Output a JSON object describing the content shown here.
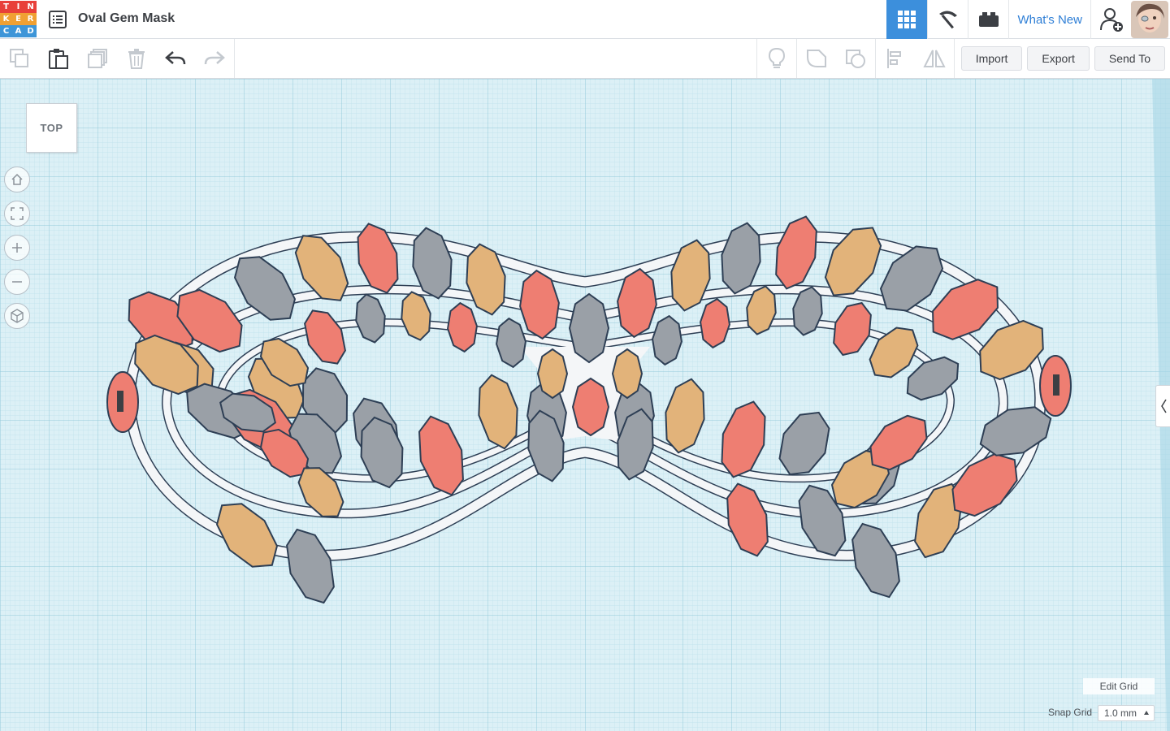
{
  "app": {
    "logo_letters": [
      "T",
      "I",
      "N",
      "K",
      "E",
      "R",
      "C",
      "A",
      "D"
    ],
    "logo_colors": [
      "#e8403a",
      "#e8403a",
      "#e8403a",
      "#f0a033",
      "#f0a033",
      "#f0a033",
      "#3d95d8",
      "#3d95d8",
      "#3d95d8"
    ],
    "design_title": "Oval Gem Mask",
    "whats_new_label": "What's New",
    "accent_color": "#3c8fdc"
  },
  "toolbar": {
    "left_icons": [
      "copy-icon",
      "paste-icon",
      "duplicate-icon",
      "delete-icon",
      "undo-icon",
      "redo-icon"
    ],
    "right_icons": [
      "note-icon",
      "group-icon",
      "ungroup-icon",
      "align-icon",
      "mirror-icon"
    ],
    "import_label": "Import",
    "export_label": "Export",
    "send_to_label": "Send To"
  },
  "viewcube": {
    "face_label": "TOP"
  },
  "nav_controls": [
    "home-icon",
    "fit-view-icon",
    "zoom-in-icon",
    "zoom-out-icon",
    "ortho-icon"
  ],
  "grid": {
    "edit_grid_label": "Edit Grid",
    "snap_grid_label": "Snap Grid",
    "snap_grid_value": "1.0 mm"
  },
  "gem_colors": {
    "red": "#ee7e72",
    "tan": "#e2b37a",
    "gray": "#9aa0a7",
    "outline": "#2e3f55",
    "grid": "#c8e8f0"
  }
}
